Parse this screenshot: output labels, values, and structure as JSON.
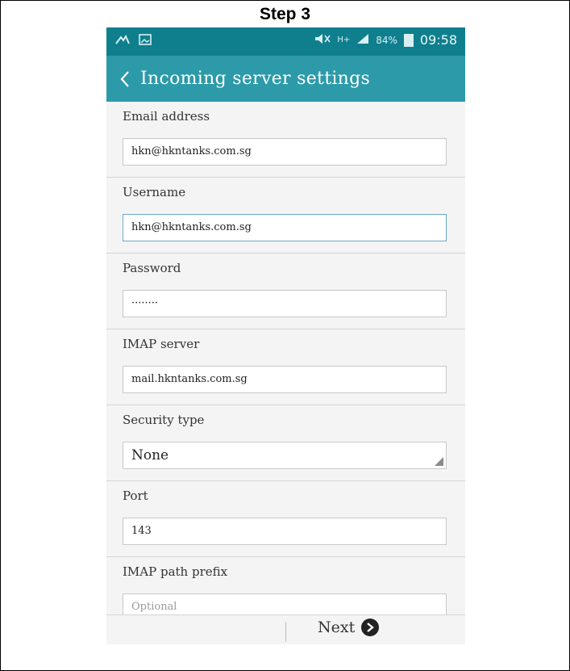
{
  "step_title": "Step 3",
  "status_bar": {
    "battery_percent": "84%",
    "time": "09:58",
    "network": "H+"
  },
  "action_bar": {
    "title": "Incoming server settings"
  },
  "fields": [
    {
      "label": "Email address",
      "value": "hkn@hkntanks.com.sg"
    },
    {
      "label": "Username",
      "value": "hkn@hkntanks.com.sg"
    },
    {
      "label": "Password",
      "value": "········"
    },
    {
      "label": "IMAP server",
      "value": "mail.hkntanks.com.sg"
    },
    {
      "label": "Security type",
      "value": "None"
    },
    {
      "label": "Port",
      "value": "143"
    },
    {
      "label": "IMAP path prefix",
      "placeholder": "Optional"
    }
  ],
  "bottom_bar": {
    "next_label": "Next"
  },
  "colors": {
    "status_bar": "#0f7f8e",
    "action_bar": "#2c9aa9",
    "focus_border": "#6aa9c8"
  }
}
